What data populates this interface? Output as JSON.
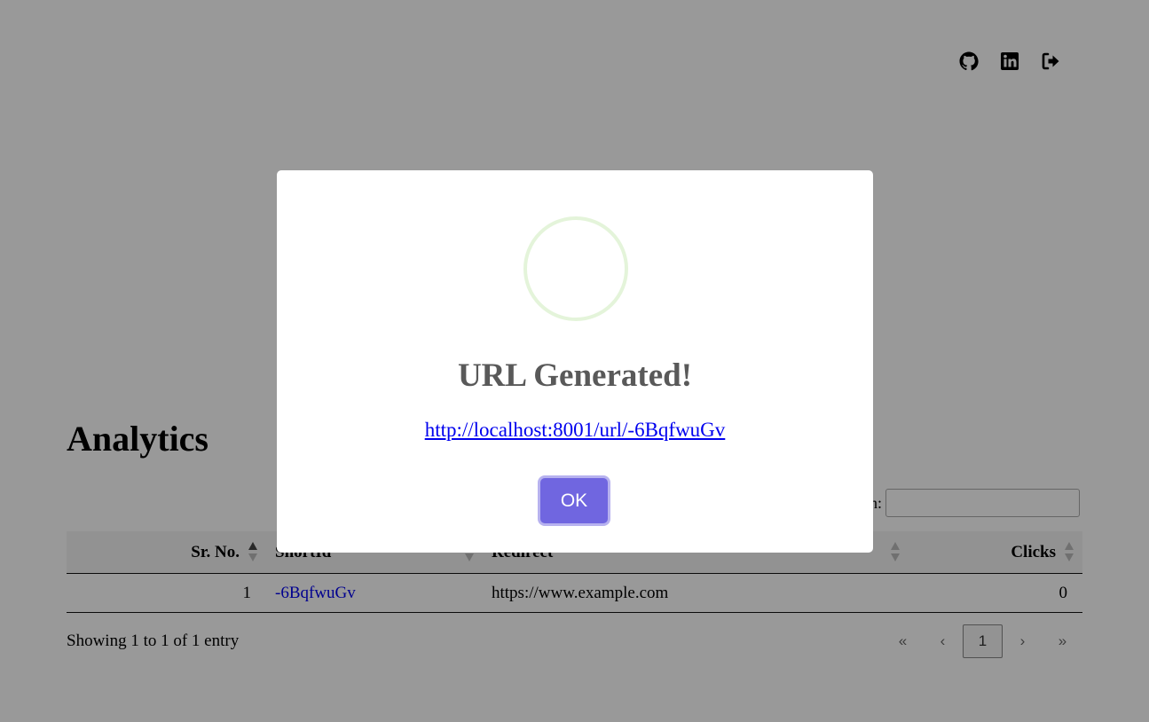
{
  "header": {
    "icons": [
      {
        "name": "github-icon"
      },
      {
        "name": "linkedin-icon"
      },
      {
        "name": "logout-icon"
      }
    ]
  },
  "analytics": {
    "title": "Analytics",
    "search": {
      "label": "Search:",
      "value": ""
    },
    "columns": [
      "Sr. No.",
      "ShortId",
      "Redirect",
      "Clicks"
    ],
    "rows": [
      {
        "sr": "1",
        "shortId": "-6BqfwuGv",
        "redirect": "https://www.example.com",
        "clicks": "0"
      }
    ],
    "info": "Showing 1 to 1 of 1 entry",
    "pagination": {
      "first": "«",
      "prev": "‹",
      "current": "1",
      "next": "›",
      "last": "»"
    }
  },
  "modal": {
    "title": "URL Generated!",
    "link": "http://localhost:8001/url/-6BqfwuGv",
    "ok_label": "OK",
    "colors": {
      "ok_button": "#7066e0",
      "success_ring": "#a5dc86",
      "overlay": "rgba(0,0,0,0.4)"
    }
  }
}
